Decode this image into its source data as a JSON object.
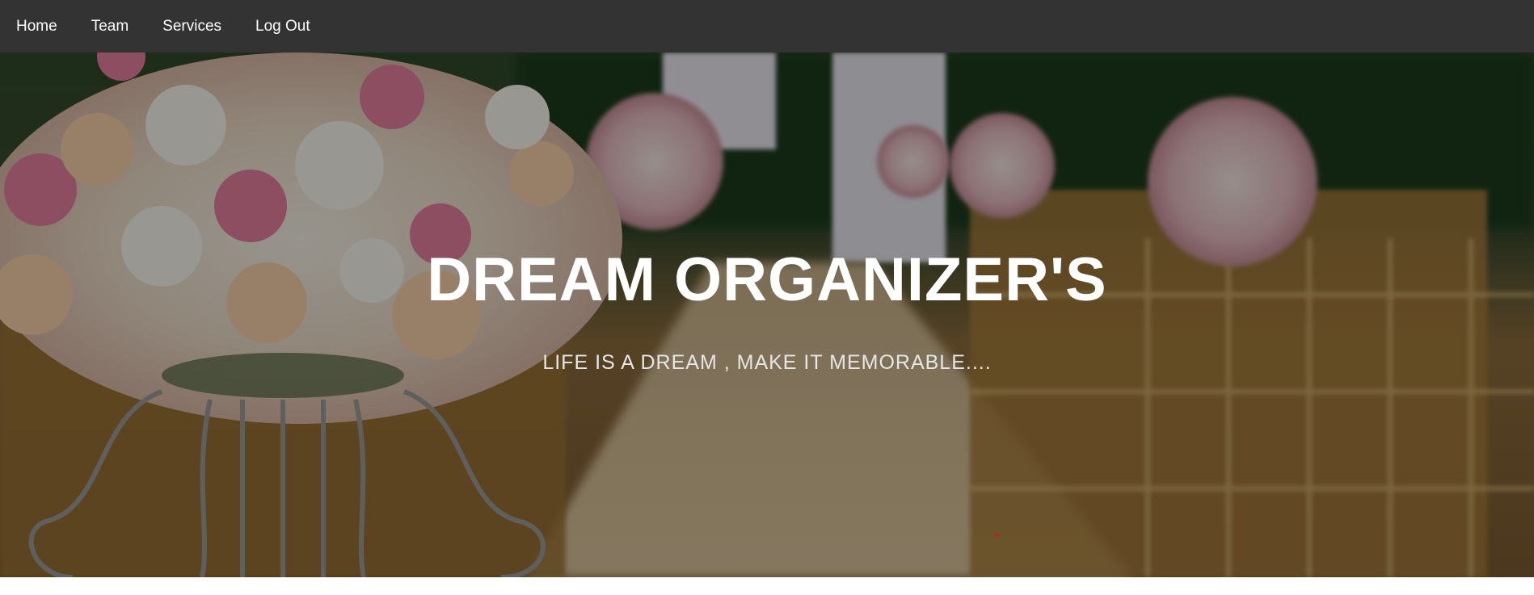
{
  "nav": {
    "items": [
      {
        "label": "Home"
      },
      {
        "label": "Team"
      },
      {
        "label": "Services"
      },
      {
        "label": "Log Out"
      }
    ]
  },
  "hero": {
    "title": "DREAM ORGANIZER'S",
    "subtitle": "LIFE IS A DREAM , MAKE IT MEMORABLE....",
    "background_image": "wedding-aisle-flowers-photo"
  },
  "colors": {
    "navbar": "#333333",
    "nav_text": "#ffffff",
    "title_text": "#ffffff",
    "subtitle_text": "#e6e6e6"
  }
}
